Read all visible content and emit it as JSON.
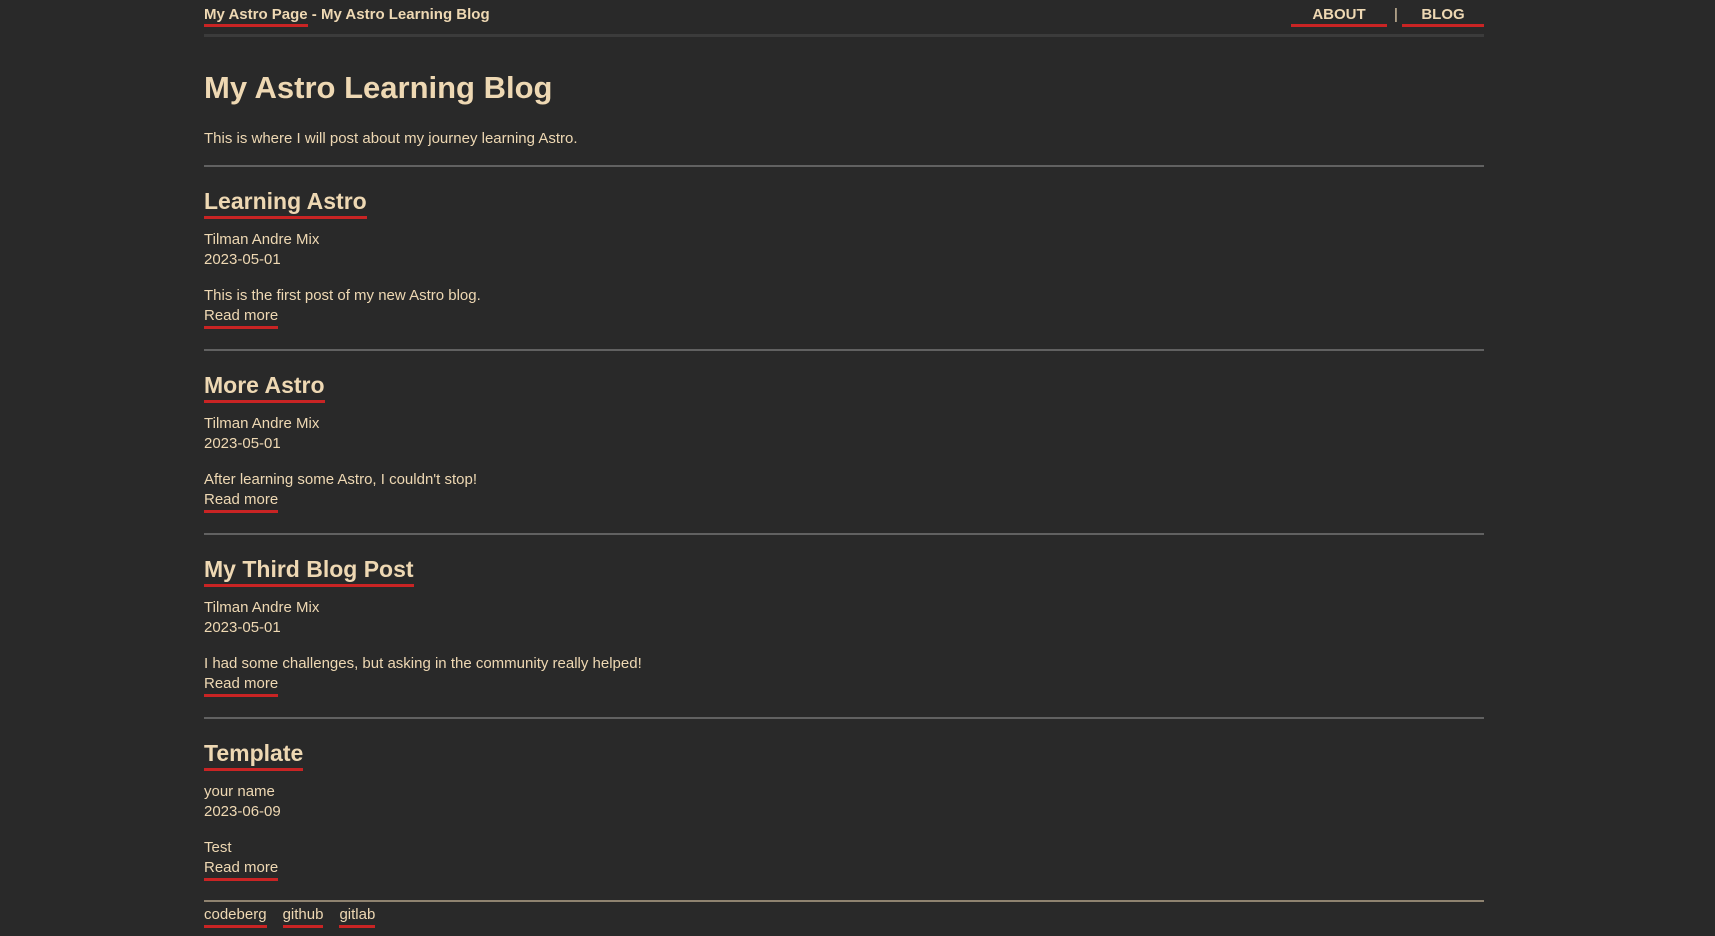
{
  "header": {
    "home_link": "My Astro Page",
    "breadcrumb_separator": " - ",
    "current_page": "My Astro Learning Blog",
    "nav": {
      "about": "ABOUT",
      "separator": "|",
      "blog": "BLOG"
    }
  },
  "main": {
    "title": "My Astro Learning Blog",
    "description": "This is where I will post about my journey learning Astro.",
    "read_more_label": "Read more",
    "posts": [
      {
        "title": "Learning Astro",
        "author": "Tilman Andre Mix",
        "date": "2023-05-01",
        "description": "This is the first post of my new Astro blog.",
        "read_more": "Read more"
      },
      {
        "title": "More Astro",
        "author": "Tilman Andre Mix",
        "date": "2023-05-01",
        "description": "After learning some Astro, I couldn't stop!",
        "read_more": "Read more"
      },
      {
        "title": "My Third Blog Post",
        "author": "Tilman Andre Mix",
        "date": "2023-05-01",
        "description": "I had some challenges, but asking in the community really helped!",
        "read_more": "Read more"
      },
      {
        "title": "Template",
        "author": "your name",
        "date": "2023-06-09",
        "description": "Test",
        "read_more": "Read more"
      }
    ]
  },
  "footer": {
    "links": [
      "codeberg",
      "github",
      "gitlab"
    ]
  },
  "colors": {
    "background": "#292929",
    "text": "#eed8b3",
    "link_underline": "#c92424",
    "divider": "#616161"
  }
}
